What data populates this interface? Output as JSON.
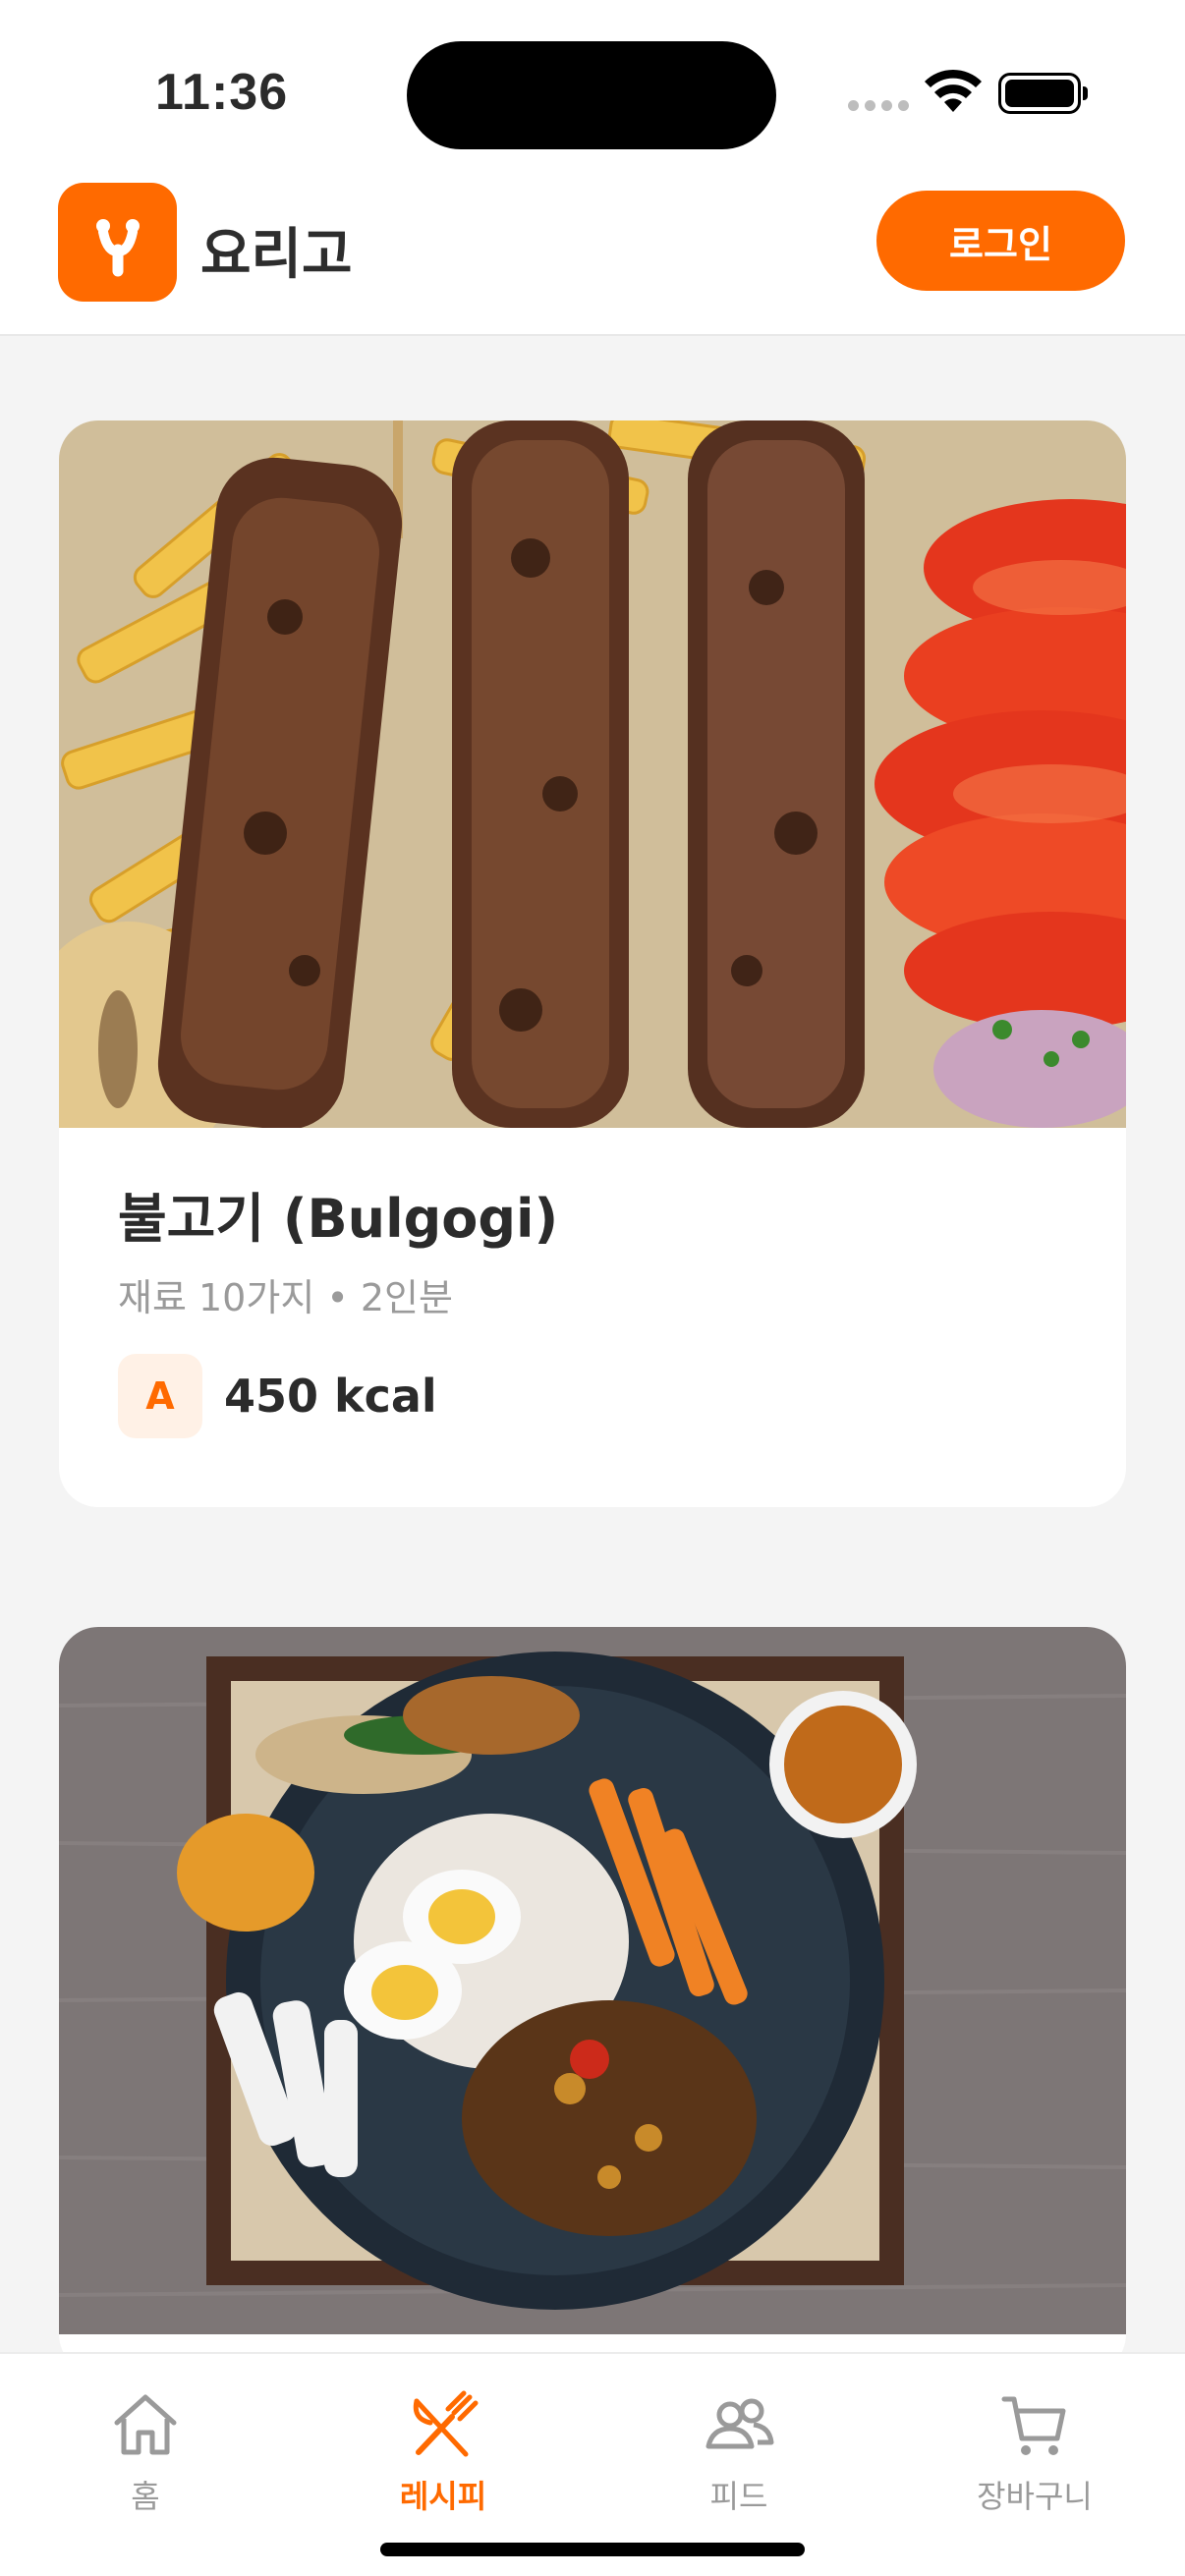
{
  "status": {
    "time": "11:36"
  },
  "header": {
    "app_name": "요리고",
    "login_label": "로그인"
  },
  "recipes": [
    {
      "title": "불고기 (Bulgogi)",
      "meta": "재료 10가지 • 2인분",
      "grade": "A",
      "calories": "450 kcal"
    }
  ],
  "tabs": [
    {
      "label": "홈",
      "icon": "home-icon",
      "active": false
    },
    {
      "label": "레시피",
      "icon": "utensils-icon",
      "active": true
    },
    {
      "label": "피드",
      "icon": "users-icon",
      "active": false
    },
    {
      "label": "장바구니",
      "icon": "cart-icon",
      "active": false
    }
  ],
  "colors": {
    "accent": "#ff6a00",
    "background": "#f4f4f4",
    "muted_text": "#9a9a9a"
  }
}
